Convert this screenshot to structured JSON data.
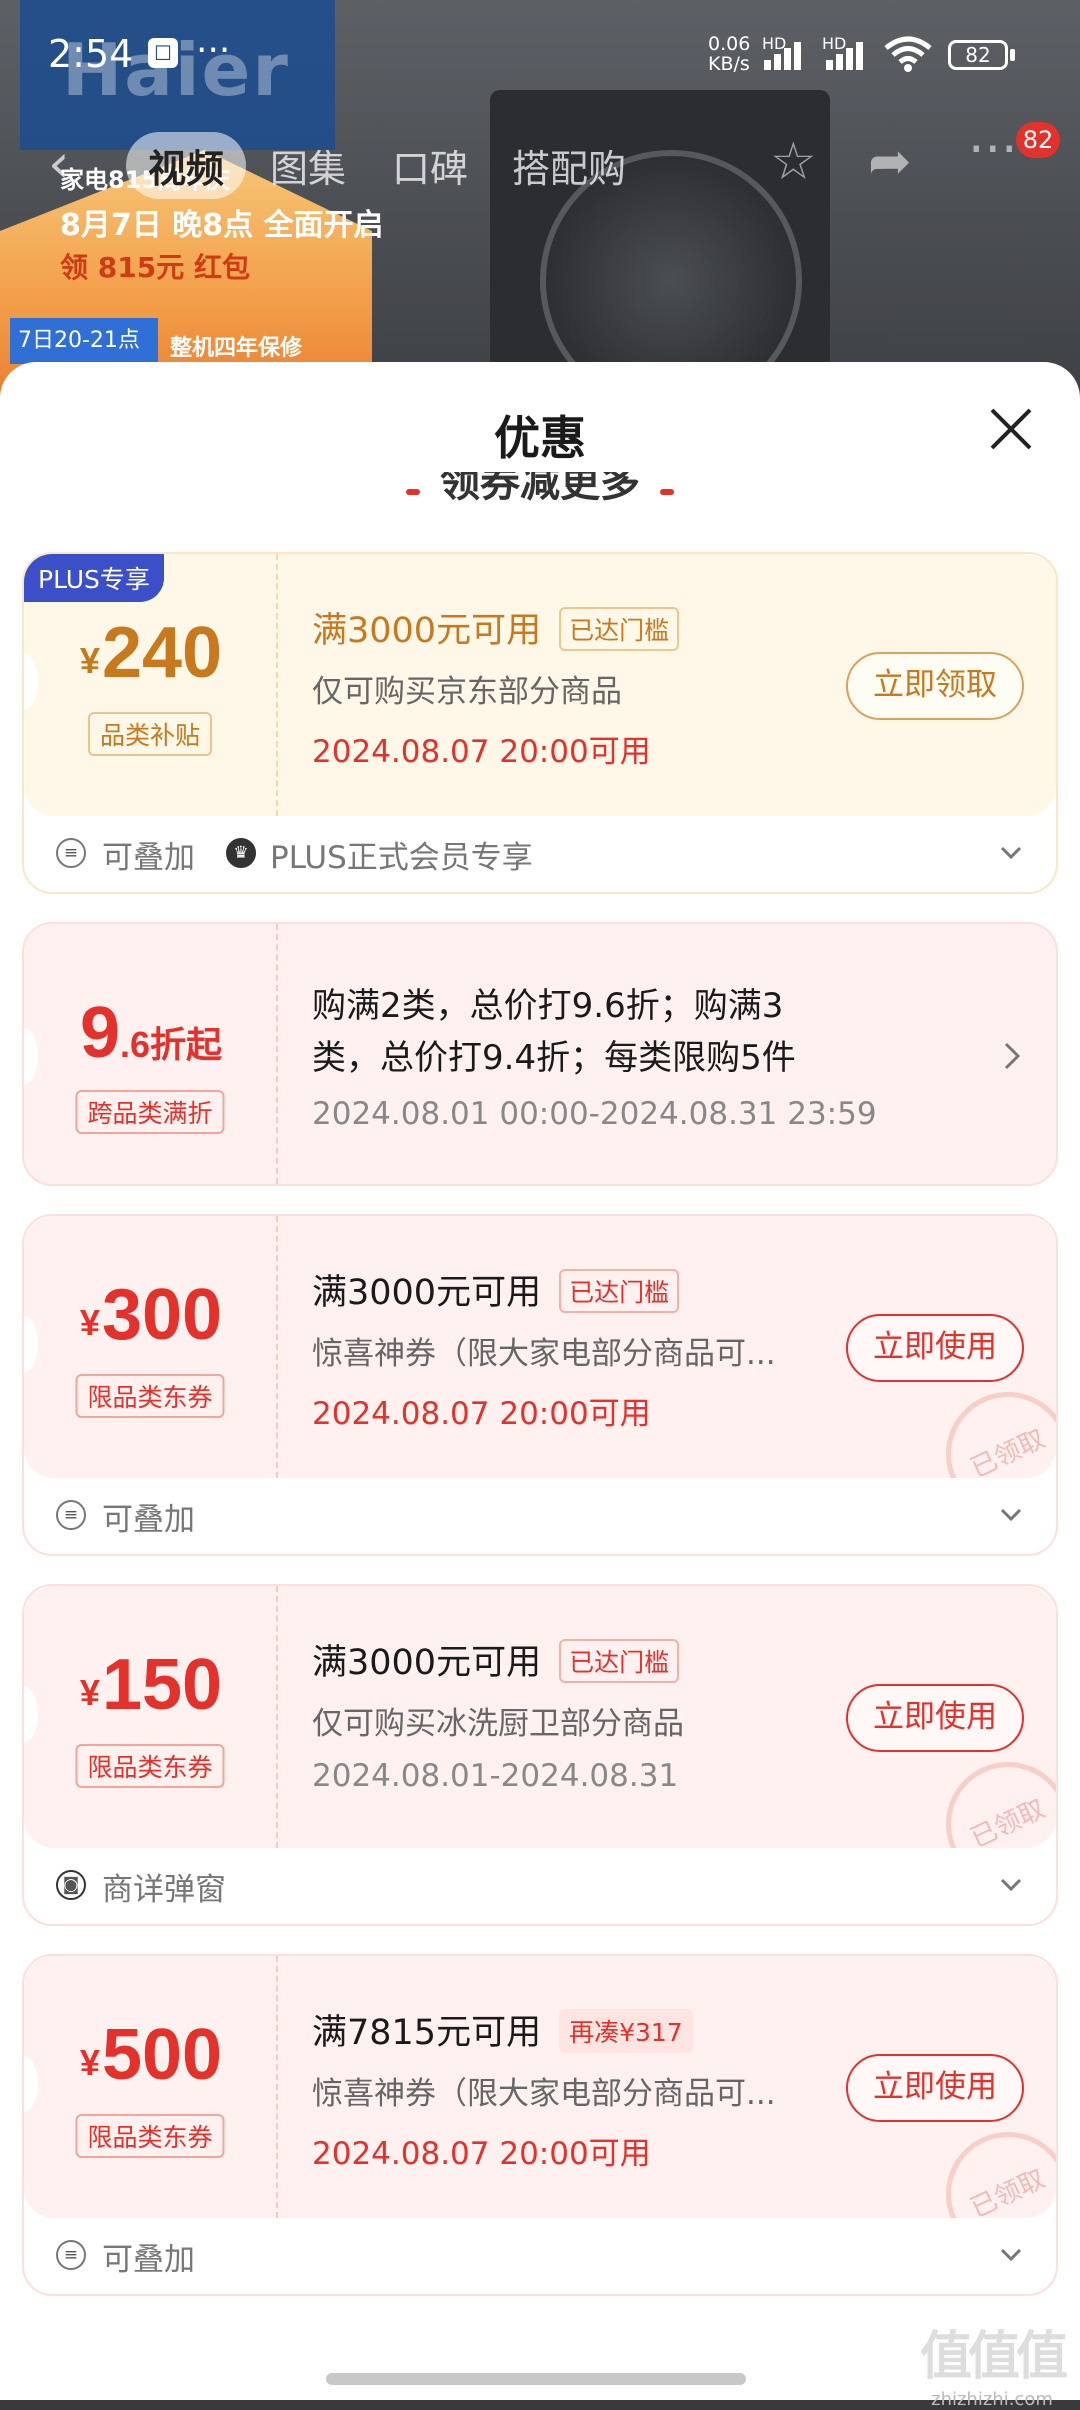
{
  "status_bar": {
    "time": "2:54",
    "more": "···",
    "net_speed_value": "0.06",
    "net_speed_unit": "KB/s",
    "hd1": "HD",
    "hd2": "HD",
    "battery": "82"
  },
  "background": {
    "brand": "Haier",
    "promo_line1": "家电815周年庆",
    "promo_line2": "8月7日 晚8点 全面开启",
    "promo_line3": "领 815元 红包",
    "promo_line4": "7日20-21点",
    "promo_line5": "整机四年保修"
  },
  "nav": {
    "tabs": [
      "视频",
      "图集",
      "口碑",
      "搭配购"
    ],
    "active_tab": 0,
    "badge": "82"
  },
  "sheet": {
    "title": "优惠",
    "peek_text": "领券减更多"
  },
  "coupons": [
    {
      "badge": "PLUS专享",
      "currency": "¥",
      "amount": "240",
      "tag": "品类补贴",
      "condition": "满3000元可用",
      "chip": "已达门槛",
      "desc": "仅可购买京东部分商品",
      "date": "2024.08.07 20:00可用",
      "button": "立即领取",
      "footer_items": [
        "可叠加",
        "PLUS正式会员专享"
      ]
    },
    {
      "amount_big": "9",
      "amount_small": ".6折起",
      "tag": "跨品类满折",
      "line1": "购满2类，总价打9.6折；购满3",
      "line2": "类，总价打9.4折；每类限购5件",
      "date": "2024.08.01 00:00-2024.08.31 23:59"
    },
    {
      "currency": "¥",
      "amount": "300",
      "tag": "限品类东券",
      "condition": "满3000元可用",
      "chip": "已达门槛",
      "desc": "惊喜神券（限大家电部分商品可...",
      "date": "2024.08.07 20:00可用",
      "button": "立即使用",
      "stamp": "已领取",
      "footer": "可叠加"
    },
    {
      "currency": "¥",
      "amount": "150",
      "tag": "限品类东券",
      "condition": "满3000元可用",
      "chip": "已达门槛",
      "desc": "仅可购买冰洗厨卫部分商品",
      "date": "2024.08.01-2024.08.31",
      "button": "立即使用",
      "stamp": "已领取",
      "footer": "商详弹窗"
    },
    {
      "currency": "¥",
      "amount": "500",
      "tag": "限品类东券",
      "condition": "满7815元可用",
      "chip": "再凑¥317",
      "desc": "惊喜神券（限大家电部分商品可...",
      "date": "2024.08.07 20:00可用",
      "button": "立即使用",
      "stamp": "已领取",
      "footer": "可叠加"
    }
  ],
  "watermark": {
    "logo": "值值值",
    "site": "zhizhizhi.com"
  },
  "colors": {
    "accent_red": "#e3322b",
    "gold": "#c8791e",
    "plus_blue": "#3b4fc9",
    "gold_bg": "#fff8e8",
    "pink_bg": "#fff1ef"
  }
}
